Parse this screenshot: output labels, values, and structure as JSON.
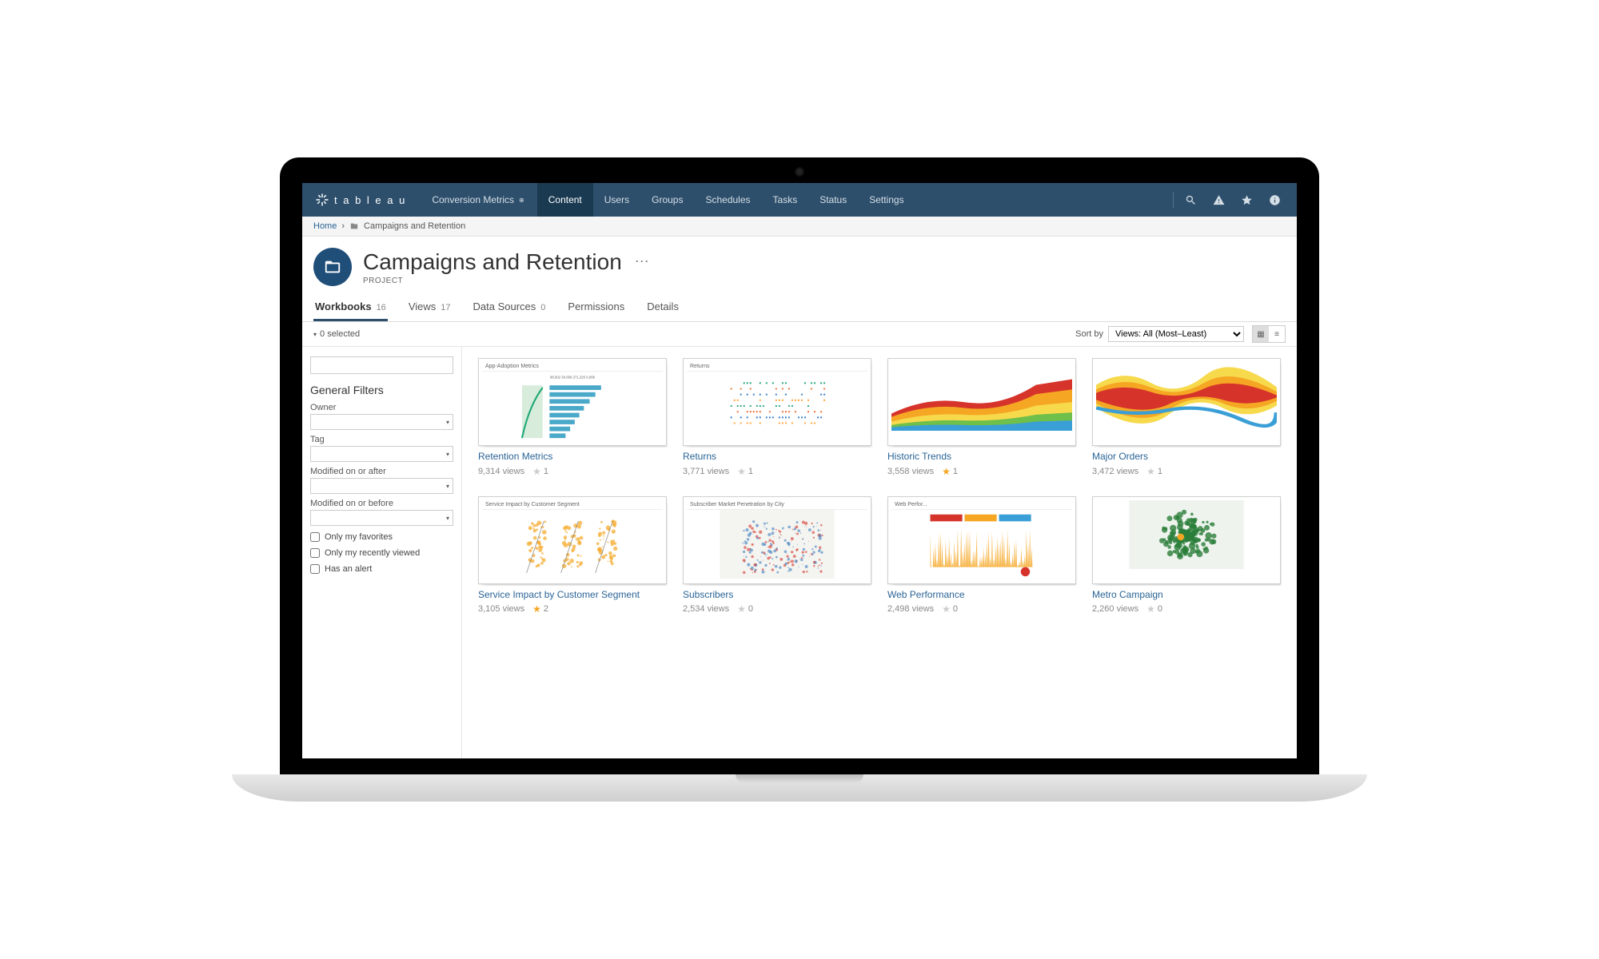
{
  "brand": "t a b l e a u",
  "site_selector": "Conversion Metrics",
  "nav": {
    "items": [
      "Content",
      "Users",
      "Groups",
      "Schedules",
      "Tasks",
      "Status",
      "Settings"
    ],
    "active": 0
  },
  "breadcrumb": {
    "home": "Home",
    "current": "Campaigns and Retention"
  },
  "header": {
    "title": "Campaigns and Retention",
    "subtitle": "PROJECT"
  },
  "tabs": [
    {
      "label": "Workbooks",
      "count": "16"
    },
    {
      "label": "Views",
      "count": "17"
    },
    {
      "label": "Data Sources",
      "count": "0"
    },
    {
      "label": "Permissions",
      "count": ""
    },
    {
      "label": "Details",
      "count": ""
    }
  ],
  "tabs_active": 0,
  "toolbar": {
    "selected_text": "0 selected",
    "sort_label": "Sort by",
    "sort_value": "Views: All (Most–Least)"
  },
  "filters": {
    "title": "General Filters",
    "owner": "Owner",
    "tag": "Tag",
    "after": "Modified on or after",
    "before": "Modified on or before",
    "only_fav": "Only my favorites",
    "only_recent": "Only my recently viewed",
    "has_alert": "Has an alert"
  },
  "workbooks": [
    {
      "title": "Retention Metrics",
      "views": "9,314 views",
      "fav": false,
      "fav_count": "1",
      "thumb_label": "App-Adoption Metrics",
      "thumb_type": "bars"
    },
    {
      "title": "Returns",
      "views": "3,771 views",
      "fav": false,
      "fav_count": "1",
      "thumb_label": "Returns",
      "thumb_type": "dots"
    },
    {
      "title": "Historic Trends",
      "views": "3,558 views",
      "fav": true,
      "fav_count": "1",
      "thumb_label": "",
      "thumb_type": "area"
    },
    {
      "title": "Major Orders",
      "views": "3,472 views",
      "fav": false,
      "fav_count": "1",
      "thumb_label": "",
      "thumb_type": "stream"
    },
    {
      "title": "Service Impact by Customer Segment",
      "views": "3,105 views",
      "fav": true,
      "fav_count": "2",
      "thumb_label": "Service Impact by Customer Segment",
      "thumb_type": "scatter"
    },
    {
      "title": "Subscribers",
      "views": "2,534 views",
      "fav": false,
      "fav_count": "0",
      "thumb_label": "Subscriber Market Penetration by City",
      "thumb_type": "map"
    },
    {
      "title": "Web Performance",
      "views": "2,498 views",
      "fav": false,
      "fav_count": "0",
      "thumb_label": "Web Perfor...",
      "thumb_type": "spikes"
    },
    {
      "title": "Metro Campaign",
      "views": "2,260 views",
      "fav": false,
      "fav_count": "0",
      "thumb_label": "",
      "thumb_type": "geo"
    }
  ]
}
